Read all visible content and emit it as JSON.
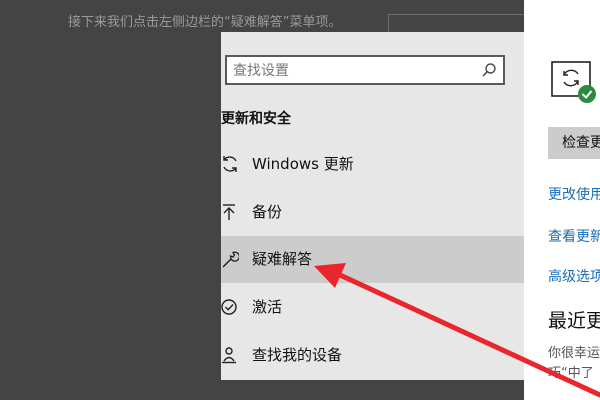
{
  "document": {
    "instruction_text": "接下来我们点击左侧边栏的“疑难解答”菜单项。"
  },
  "search": {
    "placeholder": "查找设置"
  },
  "sidebar": {
    "section_title": "更新和安全",
    "items": [
      {
        "label": "Windows 更新",
        "icon": "sync-icon"
      },
      {
        "label": "备份",
        "icon": "backup-arrow-icon"
      },
      {
        "label": "疑难解答",
        "icon": "wrench-icon",
        "selected": true
      },
      {
        "label": "激活",
        "icon": "check-circle-icon"
      },
      {
        "label": "查找我的设备",
        "icon": "person-pin-icon"
      }
    ]
  },
  "main": {
    "check_button_label": "检查更",
    "links": [
      "更改使用",
      "查看更新",
      "高级选项"
    ],
    "recent_heading": "最近更",
    "tip_lines": [
      "你很幸运",
      "巧“中了"
    ]
  },
  "colors": {
    "accent": "#1a6db5",
    "arrow": "#e8262b",
    "badge": "#2e8b3e"
  }
}
